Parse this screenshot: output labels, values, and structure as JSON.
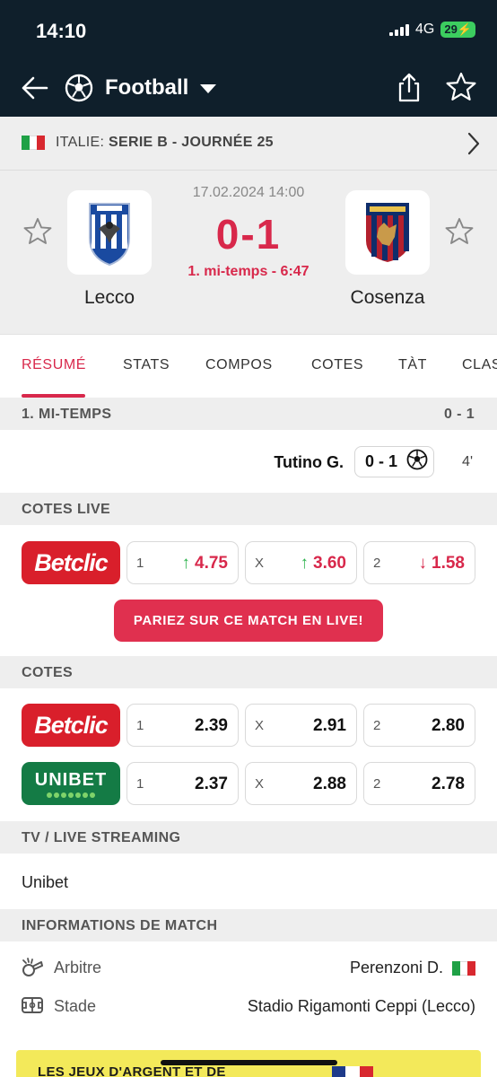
{
  "status": {
    "time": "14:10",
    "network": "4G",
    "battery": "29"
  },
  "appbar": {
    "title": "Football"
  },
  "league": {
    "country": "ITALIE:",
    "name": "SERIE B - JOURNÉE 25",
    "flag_colors": [
      "#1fa146",
      "#ffffff",
      "#d8282f"
    ]
  },
  "match": {
    "datetime": "17.02.2024 14:00",
    "score": "0-1",
    "status": "1. mi-temps - 6:47",
    "home": {
      "name": "Lecco"
    },
    "away": {
      "name": "Cosenza"
    }
  },
  "tabs": [
    "RÉSUMÉ",
    "STATS",
    "COMPOS",
    "COTES",
    "TÀT",
    "CLAS"
  ],
  "summary": {
    "header": "1. MI-TEMPS",
    "header_score": "0 - 1",
    "events": [
      {
        "player": "Tutino G.",
        "score": "0 - 1",
        "minute": "4'",
        "icon": "soccer-ball-icon"
      }
    ]
  },
  "live_odds": {
    "header": "COTES LIVE",
    "bookmaker": "Betclic",
    "odds": [
      {
        "key": "1",
        "value": "4.75",
        "trend": "up"
      },
      {
        "key": "X",
        "value": "3.60",
        "trend": "up"
      },
      {
        "key": "2",
        "value": "1.58",
        "trend": "down"
      }
    ],
    "cta": "PARIEZ SUR CE MATCH EN LIVE!"
  },
  "odds": {
    "header": "COTES",
    "rows": [
      {
        "bookmaker": "Betclic",
        "odds": [
          {
            "key": "1",
            "value": "2.39"
          },
          {
            "key": "X",
            "value": "2.91"
          },
          {
            "key": "2",
            "value": "2.80"
          }
        ]
      },
      {
        "bookmaker": "UNIBET",
        "odds": [
          {
            "key": "1",
            "value": "2.37"
          },
          {
            "key": "X",
            "value": "2.88"
          },
          {
            "key": "2",
            "value": "2.78"
          }
        ]
      }
    ]
  },
  "tv": {
    "header": "TV / LIVE STREAMING",
    "items": [
      "Unibet"
    ]
  },
  "info": {
    "header": "INFORMATIONS DE MATCH",
    "referee_label": "Arbitre",
    "referee_value": "Perenzoni D.",
    "stadium_label": "Stade",
    "stadium_value": "Stadio Rigamonti Ceppi (Lecco)"
  },
  "banner": {
    "text": "LES JEUX D'ARGENT ET DE"
  },
  "colors": {
    "accent": "#d8284b",
    "header_bg": "#0f1f2b",
    "betclic": "#d91f2b",
    "unibet": "#147b45",
    "odds_up": "#2bb24c"
  }
}
